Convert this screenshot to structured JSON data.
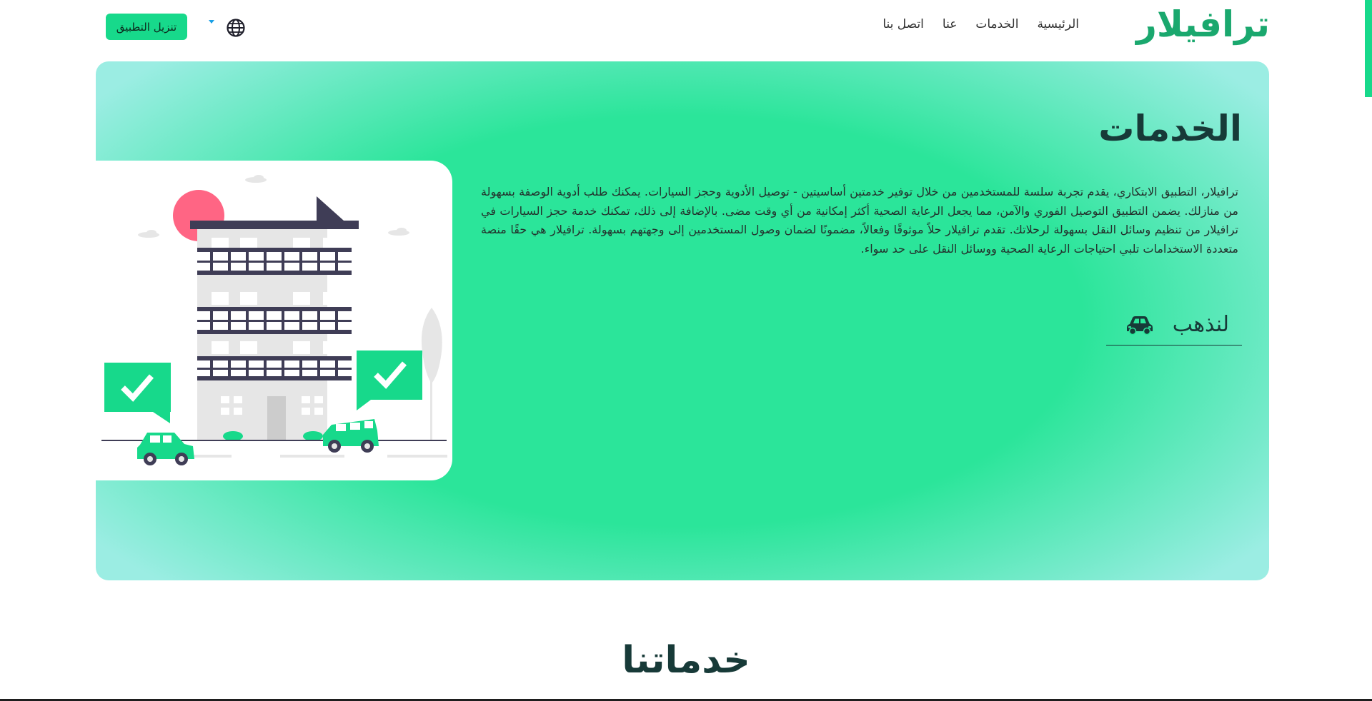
{
  "header": {
    "logo": "ترافيلار",
    "nav": [
      {
        "label": "الرئيسية"
      },
      {
        "label": "الخدمات"
      },
      {
        "label": "عنا"
      },
      {
        "label": "اتصل بنا"
      }
    ],
    "language_icon": "globe-icon",
    "download_label": "تنزيل التطبيق"
  },
  "hero": {
    "title": "الخدمات",
    "description": "ترافيلار، التطبيق الابتكاري، يقدم تجربة سلسة للمستخدمين من خلال توفير خدمتين أساسيتين - توصيل الأدوية وحجز السيارات. يمكنك طلب أدوية الوصفة بسهولة من منازلك. يضمن التطبيق التوصيل الفوري والآمن، مما يجعل الرعاية الصحية أكثر إمكانية من أي وقت مضى. بالإضافة إلى ذلك، تمكنك خدمة حجز السيارات في ترافيلار من تنظيم وسائل النقل بسهولة لرحلاتك. تقدم ترافيلار حلاً موثوقًا وفعالاً، مضمونًا لضمان وصول المستخدمين إلى وجهتهم بسهولة. ترافيلار هي حقًا منصة متعددة الاستخدامات تلبي احتياجات الرعاية الصحية ووسائل النقل على حد سواء.",
    "go_label": "لنذهب",
    "go_icon": "car-icon"
  },
  "section": {
    "title": "خدماتنا"
  },
  "colors": {
    "brand": "#17d98b",
    "brand_text": "#1aa86e",
    "dark": "#173a38",
    "hero_edge": "#9bede3"
  }
}
